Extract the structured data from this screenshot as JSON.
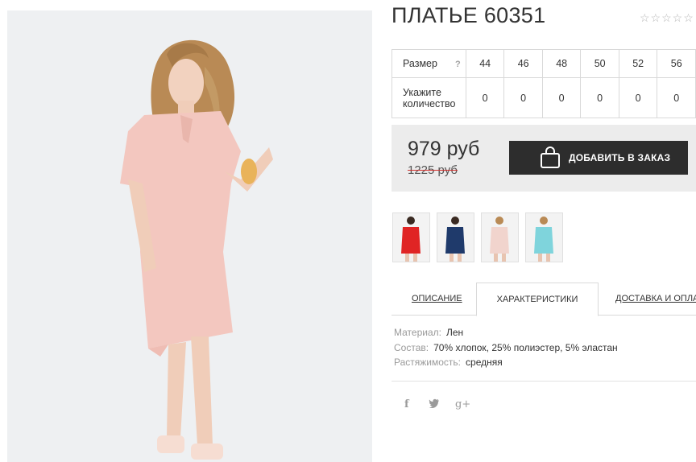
{
  "product": {
    "title": "ПЛАТЬЕ 60351",
    "rating_stars": "☆☆☆☆☆",
    "rating_value": 0
  },
  "sizes": {
    "size_label": "Размер",
    "help_mark": "?",
    "qty_label": "Укажите количество",
    "columns": [
      "44",
      "46",
      "48",
      "50",
      "52",
      "56"
    ],
    "quantities": [
      "0",
      "0",
      "0",
      "0",
      "0",
      "0"
    ]
  },
  "buy": {
    "price": "979 руб",
    "old_price": "1225 руб",
    "add_button": "ДОБАВИТЬ В ЗАКАЗ"
  },
  "colors": {
    "accent_dark": "#2d2d2d",
    "buybox_bg": "#ececec",
    "dress_main": "#f3c7bf",
    "thumb_colors": [
      "#e02424",
      "#1f3a6b",
      "#f1d4cd",
      "#7fd4dc"
    ]
  },
  "tabs": [
    {
      "label": "ОПИСАНИЕ",
      "active": false
    },
    {
      "label": "ХАРАКТЕРИСТИКИ",
      "active": true
    },
    {
      "label": "ДОСТАВКА И ОПЛАТА",
      "active": false
    }
  ],
  "specs": [
    {
      "key": "Материал:",
      "value": "Лен"
    },
    {
      "key": "Состав:",
      "value": "70% хлопок, 25% полиэстер, 5% эластан"
    },
    {
      "key": "Растяжимость:",
      "value": "средняя"
    }
  ],
  "social": {
    "facebook": "f",
    "twitter": "🐦",
    "googleplus": "g+"
  }
}
